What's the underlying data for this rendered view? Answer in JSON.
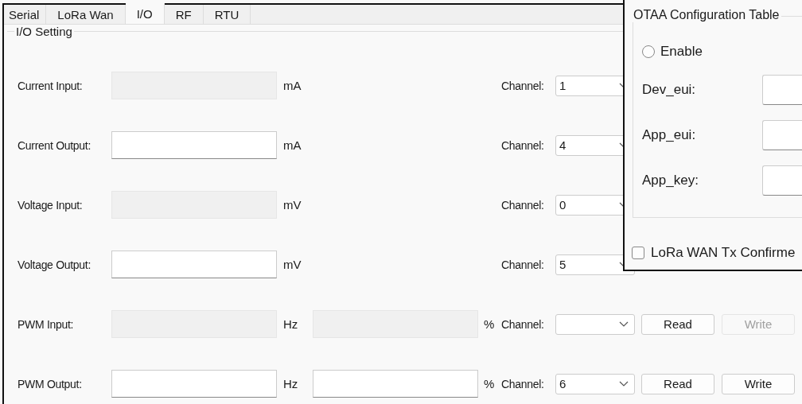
{
  "tabs": [
    {
      "label": "Serial",
      "selected": false
    },
    {
      "label": "LoRa Wan",
      "selected": false
    },
    {
      "label": "I/O",
      "selected": true
    },
    {
      "label": "RF",
      "selected": false
    },
    {
      "label": "RTU",
      "selected": false
    }
  ],
  "io_setting": {
    "title": "I/O Setting",
    "rows": [
      {
        "label": "Current Input:",
        "readonly": true,
        "unit": "mA",
        "channel_label": "Channel:",
        "channel": "1"
      },
      {
        "label": "Current Output:",
        "readonly": false,
        "unit": "mA",
        "channel_label": "Channel:",
        "channel": "4"
      },
      {
        "label": "Voltage Input:",
        "readonly": true,
        "unit": "mV",
        "channel_label": "Channel:",
        "channel": "0"
      },
      {
        "label": "Voltage Output:",
        "readonly": false,
        "unit": "mV",
        "channel_label": "Channel:",
        "channel": "5"
      },
      {
        "label": "PWM Input:",
        "readonly": true,
        "unit": "Hz",
        "duty": {
          "readonly": true,
          "unit": "%"
        },
        "channel_label": "Channel:",
        "buttons": [
          {
            "label": "Read",
            "disabled": false
          },
          {
            "label": "Write",
            "disabled": true
          }
        ]
      },
      {
        "label": "PWM Output:",
        "readonly": false,
        "unit": "Hz",
        "duty": {
          "readonly": false,
          "unit": "%"
        },
        "channel_label": "Channel:",
        "channel": "6",
        "buttons": [
          {
            "label": "Read",
            "disabled": false
          },
          {
            "label": "Write",
            "disabled": false
          }
        ]
      }
    ]
  },
  "otaa_window": {
    "title": "OTAA Configuration Table",
    "enable": {
      "label": "Enable",
      "checked": false
    },
    "fields": [
      {
        "label": "Dev_eui:"
      },
      {
        "label": "App_eui:"
      },
      {
        "label": "App_key:"
      }
    ],
    "tx_confirmed": {
      "label": "LoRa WAN Tx Confirme",
      "checked": false
    }
  }
}
